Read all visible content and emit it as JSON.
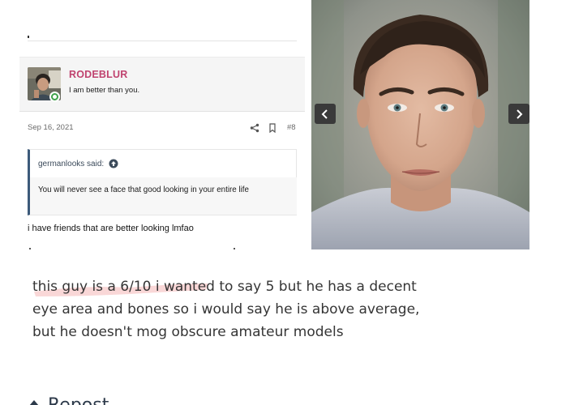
{
  "post": {
    "username": "RODEBLUR",
    "user_title": "I am better than you.",
    "date": "Sep 16, 2021",
    "post_number": "#8"
  },
  "quote": {
    "author": "germanlooks said:",
    "text": "You will never see a face that good looking in your entire life"
  },
  "reply": "i have friends that are better looking lmfao",
  "icons": {
    "share": "share-icon",
    "bookmark": "bookmark-icon",
    "quote_arrow": "circle-arrow-up-icon",
    "prev": "chevron-left-icon",
    "next": "chevron-right-icon",
    "online": "online-status-icon",
    "repost": "repost-icon"
  },
  "commentary": {
    "line1": "this guy is a 6/10 i wanted to say 5 but he has a decent",
    "line2": "eye area and bones so i would say he is above average,",
    "line3": "but he doesn't mog obscure amateur models"
  },
  "repost_label": "Repost",
  "colors": {
    "username": "#c0436f",
    "quote_border": "#3c5a7a",
    "online": "#3fa14a",
    "highlight": "#f2a7a7"
  }
}
